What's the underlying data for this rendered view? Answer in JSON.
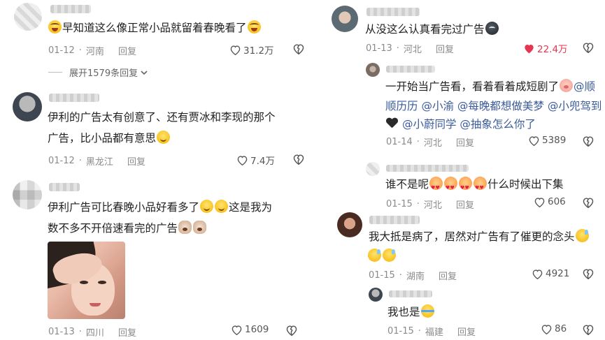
{
  "left": {
    "comments": [
      {
        "text": "早知道这么像正常小品就留着春晚看了",
        "date": "01-12",
        "location": "河南",
        "reply": "回复",
        "likes": "31.2万",
        "liked": false
      },
      {
        "text_line1": "伊利的广告太有创意了、还有贾冰和李现的那个",
        "text_line2": "广告，比小品都有意思",
        "date": "01-12",
        "location": "黑龙江",
        "reply": "回复",
        "likes": "7.4万",
        "liked": false
      },
      {
        "text_line1": "伊利广告可比春晚小品好看多了",
        "text_line1b": "这是我为",
        "text_line2": "数不多不开倍速看完的广告",
        "date": "01-13",
        "location": "四川",
        "reply": "回复",
        "likes": "1609",
        "liked": false
      }
    ],
    "expand_label": "展开1579条回复"
  },
  "right": {
    "main": {
      "text": "从没这么认真看完过广告",
      "date": "01-13",
      "location": "河北",
      "reply": "回复",
      "likes": "22.4万",
      "liked": true
    },
    "replies": [
      {
        "line1": "一开始当广告看，看着看着成短剧了",
        "mention1": "@顺",
        "line2_m1": "顺历历",
        "line2_m2": "@小渝",
        "line2_m3": "@每晚都想做美梦",
        "line2_m4": "@小兜驾到",
        "line3_m1": "@小蔚同学",
        "line3_m2": "@抽象怎么你了",
        "date": "01-14",
        "location": "河北",
        "reply": "回复",
        "likes": "5389"
      },
      {
        "line1a": "谁不是呢",
        "line1b": "什么时候出下集",
        "date": "01-15",
        "location": "河北",
        "reply": "回复",
        "likes": "606"
      }
    ],
    "main2": {
      "line1": "我大抵是病了，居然对广告有了催更的念头",
      "date": "01-15",
      "location": "湖南",
      "reply": "回复",
      "likes": "4921"
    },
    "reply3": {
      "text": "我也是",
      "date": "01-15",
      "location": "福建",
      "reply": "回复",
      "likes": "86"
    }
  },
  "colors": {
    "liked": "#e53550",
    "meta": "#8a8a8a",
    "mention": "#3a5a9a"
  }
}
